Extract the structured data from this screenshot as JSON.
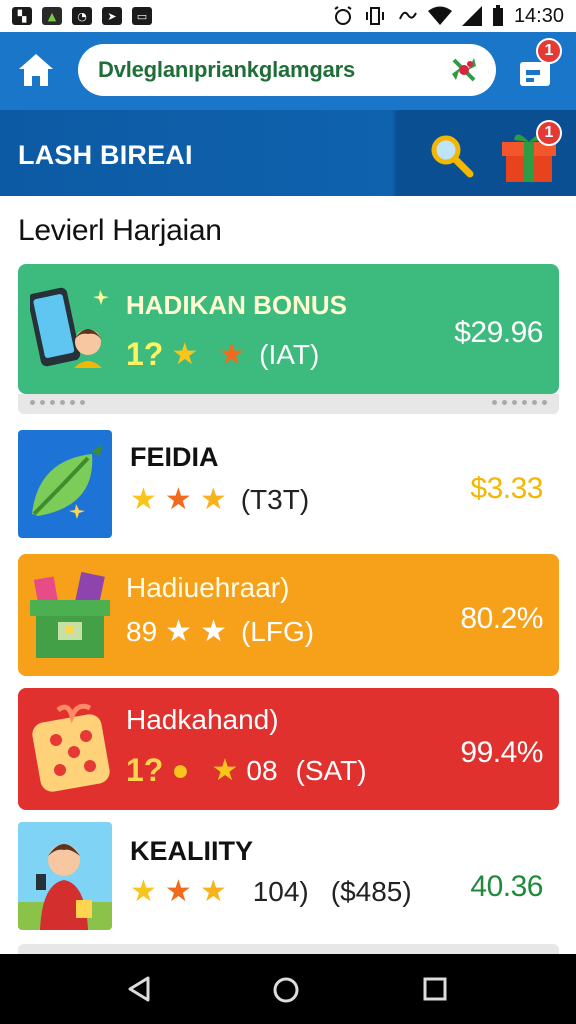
{
  "status_bar": {
    "time": "14:30",
    "notification_icons": [
      "image-icon",
      "image-icon",
      "bell-icon",
      "message-icon",
      "chat-icon"
    ],
    "system_icons": [
      "alarm-icon",
      "vibrate-icon",
      "data-icon",
      "wifi-icon",
      "signal-icon",
      "battery-icon"
    ]
  },
  "header": {
    "search_text": "Dvleglanıpriankglamgars",
    "cart_badge": "1"
  },
  "banner": {
    "title": "LASH BIREAI",
    "gift_badge": "1"
  },
  "section_title": "Levierl Harjaian",
  "items": [
    {
      "name": "HADIKAN BONUS",
      "rating_prefix": "1?",
      "rating_suffix": "(IAT)",
      "price": "$29.96",
      "bg": "#3dbb7e",
      "icon": "phone-girl-icon"
    },
    {
      "name": "FEIDIA",
      "rating_prefix": "",
      "rating_suffix": "(T3T)",
      "price": "$3.33",
      "bg": "#ffffff",
      "price_color": "#f2b705",
      "icon": "leaf-icon"
    },
    {
      "name": "Hadiuehraar)",
      "rating_prefix": "89",
      "rating_suffix": "(LFG)",
      "price": "80.2%",
      "bg": "#f7a01a",
      "icon": "treasure-box-icon"
    },
    {
      "name": "Hadkahand)",
      "rating_prefix": "1?",
      "rating_middle": "08",
      "rating_suffix": "(SAT)",
      "price": "99.4%",
      "bg": "#e0312f",
      "icon": "dice-icon"
    },
    {
      "name": "KEALIITY",
      "rating_prefix": "",
      "rating_middle": "104)",
      "rating_suffix": "($485)",
      "price": "40.36",
      "bg": "#ffffff",
      "price_color": "#1f8a3a",
      "icon": "boy-icon"
    }
  ],
  "colors": {
    "appbar": "#1a76c9",
    "banner": "#0d5aa4",
    "star_yellow": "#f7c51c",
    "star_orange": "#f26b1d"
  }
}
